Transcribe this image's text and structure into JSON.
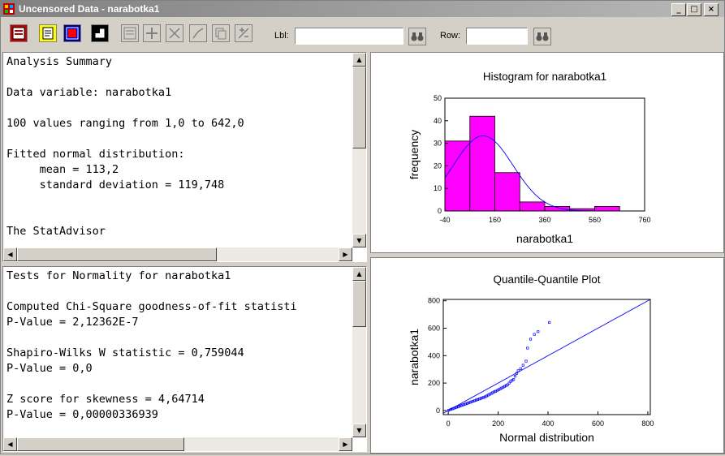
{
  "window": {
    "title": "Uncensored Data - narabotka1"
  },
  "titlebar_buttons": {
    "minimize": "_",
    "maximize": "□",
    "close": "×"
  },
  "toolbar": {
    "lbl_label": "Lbl:",
    "lbl_value": "",
    "row_label": "Row:",
    "row_value": "",
    "find_icon": "binoculars-icon",
    "tools": [
      "input-dialog-icon",
      "analysis-options-icon",
      "tables-icon",
      "graphs-icon",
      "save-results-icon",
      "exclude-icon",
      "pane-options-icon",
      "graph-options-icon",
      "copy-icon",
      "quit-icon"
    ]
  },
  "analysis_summary": {
    "lines": [
      "Analysis Summary",
      "",
      "Data variable: narabotka1",
      "",
      "100 values ranging from 1,0 to 642,0",
      "",
      "Fitted normal distribution:",
      "     mean = 113,2",
      "     standard deviation = 119,748",
      "",
      "",
      "The StatAdvisor"
    ]
  },
  "normality_tests": {
    "lines": [
      "Tests for Normality for narabotka1",
      "",
      "Computed Chi-Square goodness-of-fit statisti",
      "P-Value = 2,12362E-7",
      "",
      "Shapiro-Wilks W statistic = 0,759044",
      "P-Value = 0,0",
      "",
      "Z score for skewness = 4,64714",
      "P-Value = 0,00000336939"
    ]
  },
  "colors": {
    "bar_fill": "#ff00ff",
    "curve": "#0000ff",
    "points": "#0000ff"
  },
  "chart_data": [
    {
      "type": "bar",
      "title": "Histogram for narabotka1",
      "xlabel": "narabotka1",
      "ylabel": "frequency",
      "x_ticks": [
        -40,
        160,
        360,
        560,
        760
      ],
      "y_ticks": [
        0,
        10,
        20,
        30,
        40,
        50
      ],
      "xlim": [
        -40,
        760
      ],
      "ylim": [
        0,
        50
      ],
      "bin_edges": [
        -40,
        60,
        160,
        260,
        360,
        460,
        560,
        660
      ],
      "values": [
        31,
        42,
        17,
        4,
        2,
        1,
        2,
        1
      ],
      "fitted_normal": {
        "mean": 113.2,
        "sd": 119.748,
        "n": 100,
        "bin_width": 100
      }
    },
    {
      "type": "scatter",
      "title": "Quantile-Quantile Plot",
      "xlabel": "Normal distribution",
      "ylabel": "narabotka1",
      "x_ticks": [
        0,
        200,
        400,
        600,
        800
      ],
      "y_ticks": [
        0,
        200,
        400,
        600,
        800
      ],
      "xlim": [
        -20,
        810
      ],
      "ylim": [
        -30,
        810
      ],
      "reference_line": [
        [
          -20,
          -20
        ],
        [
          810,
          810
        ]
      ],
      "points": [
        [
          2,
          2
        ],
        [
          10,
          8
        ],
        [
          16,
          12
        ],
        [
          22,
          16
        ],
        [
          28,
          20
        ],
        [
          34,
          24
        ],
        [
          40,
          28
        ],
        [
          46,
          32
        ],
        [
          52,
          36
        ],
        [
          58,
          40
        ],
        [
          64,
          44
        ],
        [
          70,
          48
        ],
        [
          76,
          52
        ],
        [
          82,
          56
        ],
        [
          88,
          60
        ],
        [
          94,
          64
        ],
        [
          100,
          68
        ],
        [
          106,
          72
        ],
        [
          112,
          76
        ],
        [
          118,
          80
        ],
        [
          124,
          84
        ],
        [
          130,
          88
        ],
        [
          136,
          92
        ],
        [
          142,
          96
        ],
        [
          148,
          100
        ],
        [
          154,
          106
        ],
        [
          160,
          112
        ],
        [
          166,
          118
        ],
        [
          172,
          124
        ],
        [
          178,
          130
        ],
        [
          184,
          136
        ],
        [
          190,
          140
        ],
        [
          196,
          146
        ],
        [
          202,
          152
        ],
        [
          208,
          158
        ],
        [
          214,
          164
        ],
        [
          220,
          170
        ],
        [
          226,
          176
        ],
        [
          232,
          182
        ],
        [
          238,
          188
        ],
        [
          244,
          200
        ],
        [
          250,
          212
        ],
        [
          256,
          220
        ],
        [
          262,
          226
        ],
        [
          268,
          250
        ],
        [
          274,
          270
        ],
        [
          280,
          290
        ],
        [
          290,
          305
        ],
        [
          300,
          330
        ],
        [
          312,
          360
        ],
        [
          318,
          455
        ],
        [
          330,
          520
        ],
        [
          345,
          555
        ],
        [
          360,
          575
        ],
        [
          405,
          642
        ]
      ]
    }
  ]
}
